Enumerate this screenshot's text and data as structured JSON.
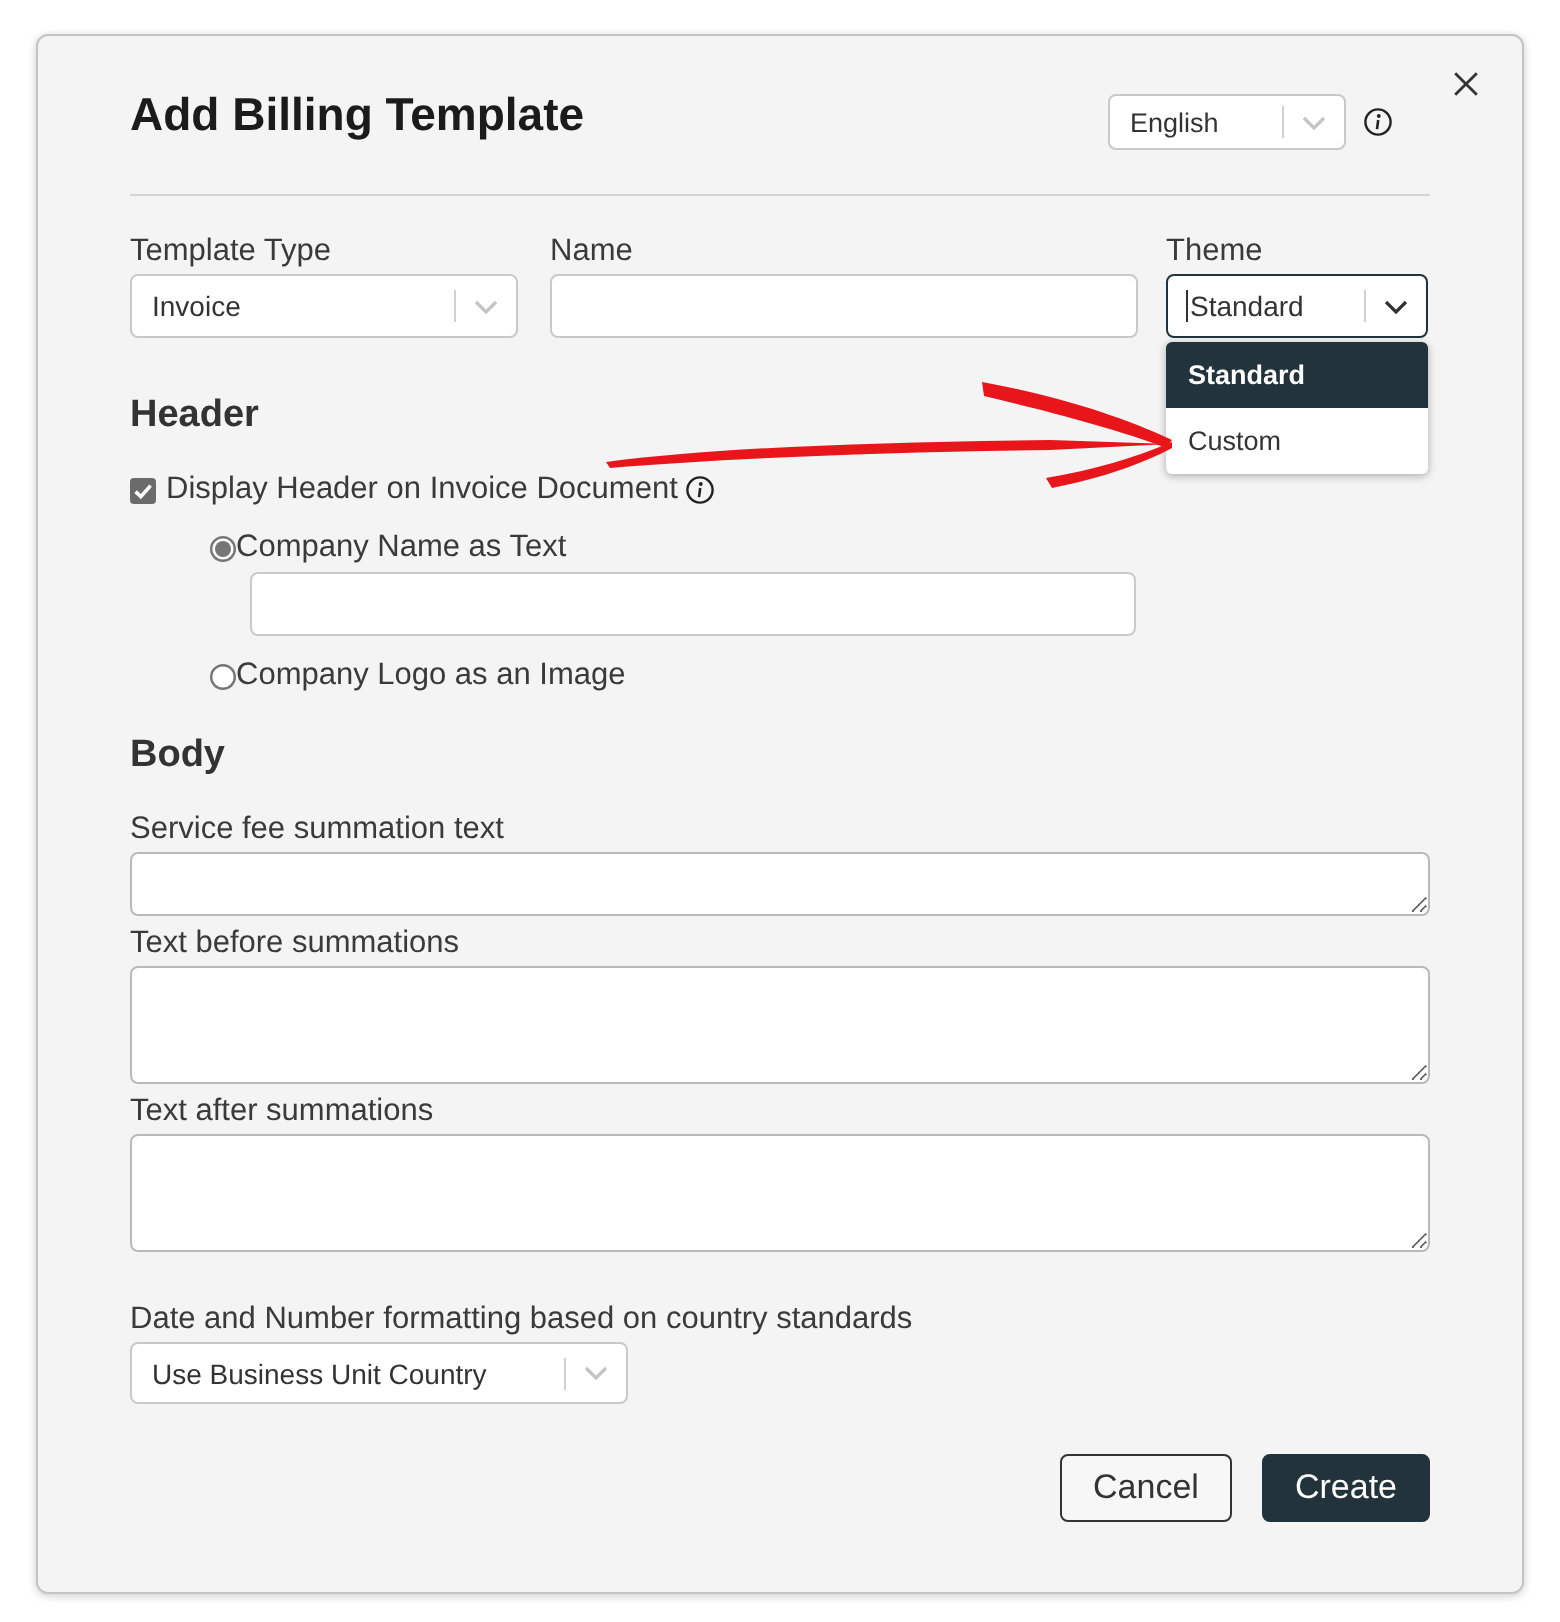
{
  "dialog": {
    "title": "Add Billing Template",
    "language": {
      "value": "English"
    }
  },
  "fields": [
    {
      "label": "Template Type",
      "kind": "select",
      "value": "Invoice",
      "expanded": false
    },
    {
      "label": "Name",
      "kind": "text"
    },
    {
      "label": "Theme",
      "kind": "select",
      "value": "Standard",
      "expanded": true,
      "options": [
        {
          "label": "Standard",
          "selected": true
        },
        {
          "label": "Custom",
          "selected": false
        }
      ]
    }
  ],
  "header": {
    "heading": "Header",
    "display_header": {
      "label": "Display Header on Invoice Document",
      "checked": true
    },
    "logo_options": [
      {
        "label": "Company Name as Text",
        "selected": true
      },
      {
        "label": "Company Logo as an Image",
        "selected": false
      }
    ]
  },
  "body": {
    "heading": "Body",
    "fields": [
      {
        "label": "Service fee summation text",
        "kind": "single"
      },
      {
        "label": "Text before summations",
        "kind": "multi"
      },
      {
        "label": "Text after summations",
        "kind": "multi"
      }
    ]
  },
  "formatting": {
    "label": "Date and Number formatting based on country standards",
    "value": "Use Business Unit Country"
  },
  "buttons": [
    {
      "label": "Cancel",
      "kind": "secondary"
    },
    {
      "label": "Create",
      "kind": "primary"
    }
  ]
}
